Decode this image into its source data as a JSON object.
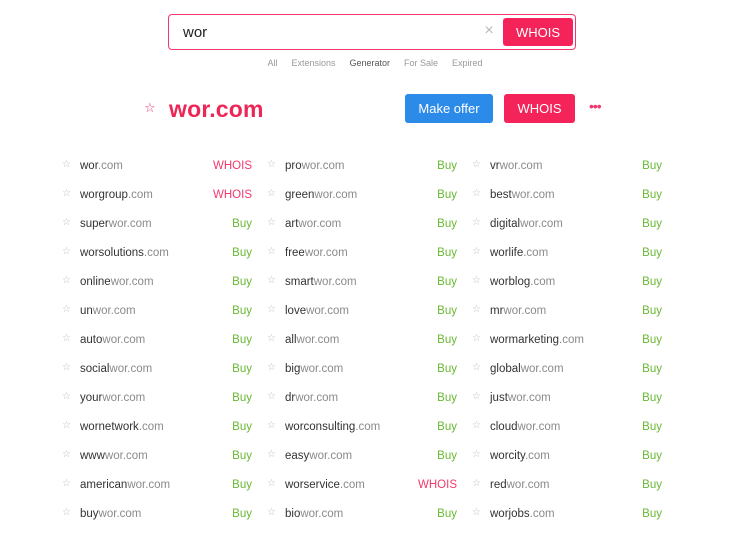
{
  "search": {
    "value": "wor",
    "clear_icon": "×",
    "button_label": "WHOIS"
  },
  "tabs": [
    {
      "label": "All",
      "active": false
    },
    {
      "label": "Extensions",
      "active": false
    },
    {
      "label": "Generator",
      "active": true
    },
    {
      "label": "For Sale",
      "active": false
    },
    {
      "label": "Expired",
      "active": false
    }
  ],
  "main": {
    "star": "☆",
    "domain": "wor.com",
    "offer_label": "Make offer",
    "whois_label": "WHOIS",
    "more_icon": "•••"
  },
  "colors": {
    "accent": "#f42359",
    "blue": "#2c8ae8",
    "buy": "#68b832"
  },
  "row_star": "☆",
  "columns": [
    [
      {
        "pre": "wor",
        "post": ".com",
        "action": "WHOIS",
        "kind": "whois"
      },
      {
        "pre": "worgroup",
        "post": ".com",
        "action": "WHOIS",
        "kind": "whois"
      },
      {
        "pre": "super",
        "post": "wor.com",
        "action": "Buy",
        "kind": "buy"
      },
      {
        "pre": "worsolutions",
        "post": ".com",
        "action": "Buy",
        "kind": "buy"
      },
      {
        "pre": "online",
        "post": "wor.com",
        "action": "Buy",
        "kind": "buy"
      },
      {
        "pre": "un",
        "post": "wor.com",
        "action": "Buy",
        "kind": "buy"
      },
      {
        "pre": "auto",
        "post": "wor.com",
        "action": "Buy",
        "kind": "buy"
      },
      {
        "pre": "social",
        "post": "wor.com",
        "action": "Buy",
        "kind": "buy"
      },
      {
        "pre": "your",
        "post": "wor.com",
        "action": "Buy",
        "kind": "buy"
      },
      {
        "pre": "wornetwork",
        "post": ".com",
        "action": "Buy",
        "kind": "buy"
      },
      {
        "pre": "www",
        "post": "wor.com",
        "action": "Buy",
        "kind": "buy"
      },
      {
        "pre": "american",
        "post": "wor.com",
        "action": "Buy",
        "kind": "buy"
      },
      {
        "pre": "buy",
        "post": "wor.com",
        "action": "Buy",
        "kind": "buy"
      }
    ],
    [
      {
        "pre": "pro",
        "post": "wor.com",
        "action": "Buy",
        "kind": "buy"
      },
      {
        "pre": "green",
        "post": "wor.com",
        "action": "Buy",
        "kind": "buy"
      },
      {
        "pre": "art",
        "post": "wor.com",
        "action": "Buy",
        "kind": "buy"
      },
      {
        "pre": "free",
        "post": "wor.com",
        "action": "Buy",
        "kind": "buy"
      },
      {
        "pre": "smart",
        "post": "wor.com",
        "action": "Buy",
        "kind": "buy"
      },
      {
        "pre": "love",
        "post": "wor.com",
        "action": "Buy",
        "kind": "buy"
      },
      {
        "pre": "all",
        "post": "wor.com",
        "action": "Buy",
        "kind": "buy"
      },
      {
        "pre": "big",
        "post": "wor.com",
        "action": "Buy",
        "kind": "buy"
      },
      {
        "pre": "dr",
        "post": "wor.com",
        "action": "Buy",
        "kind": "buy"
      },
      {
        "pre": "worconsulting",
        "post": ".com",
        "action": "Buy",
        "kind": "buy"
      },
      {
        "pre": "easy",
        "post": "wor.com",
        "action": "Buy",
        "kind": "buy"
      },
      {
        "pre": "worservice",
        "post": ".com",
        "action": "WHOIS",
        "kind": "whois"
      },
      {
        "pre": "bio",
        "post": "wor.com",
        "action": "Buy",
        "kind": "buy"
      }
    ],
    [
      {
        "pre": "vr",
        "post": "wor.com",
        "action": "Buy",
        "kind": "buy"
      },
      {
        "pre": "best",
        "post": "wor.com",
        "action": "Buy",
        "kind": "buy"
      },
      {
        "pre": "digital",
        "post": "wor.com",
        "action": "Buy",
        "kind": "buy"
      },
      {
        "pre": "worlife",
        "post": ".com",
        "action": "Buy",
        "kind": "buy"
      },
      {
        "pre": "worblog",
        "post": ".com",
        "action": "Buy",
        "kind": "buy"
      },
      {
        "pre": "mr",
        "post": "wor.com",
        "action": "Buy",
        "kind": "buy"
      },
      {
        "pre": "wormarketing",
        "post": ".com",
        "action": "Buy",
        "kind": "buy"
      },
      {
        "pre": "global",
        "post": "wor.com",
        "action": "Buy",
        "kind": "buy"
      },
      {
        "pre": "just",
        "post": "wor.com",
        "action": "Buy",
        "kind": "buy"
      },
      {
        "pre": "cloud",
        "post": "wor.com",
        "action": "Buy",
        "kind": "buy"
      },
      {
        "pre": "worcity",
        "post": ".com",
        "action": "Buy",
        "kind": "buy"
      },
      {
        "pre": "red",
        "post": "wor.com",
        "action": "Buy",
        "kind": "buy"
      },
      {
        "pre": "worjobs",
        "post": ".com",
        "action": "Buy",
        "kind": "buy"
      }
    ]
  ]
}
